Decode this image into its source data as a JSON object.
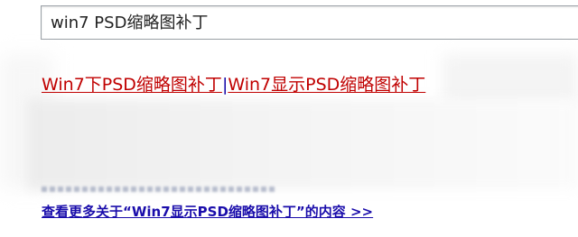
{
  "search": {
    "value": "win7 PSD缩略图补丁"
  },
  "result": {
    "title_part1": "Win7下PSD缩略图补丁",
    "separator": "|",
    "title_part2": "Win7显示PSD缩略图补丁"
  },
  "more": {
    "label": "查看更多关于“Win7显示PSD缩略图补丁”的内容 >>"
  },
  "colors": {
    "title": "#c00000",
    "link": "#1a0dab"
  }
}
